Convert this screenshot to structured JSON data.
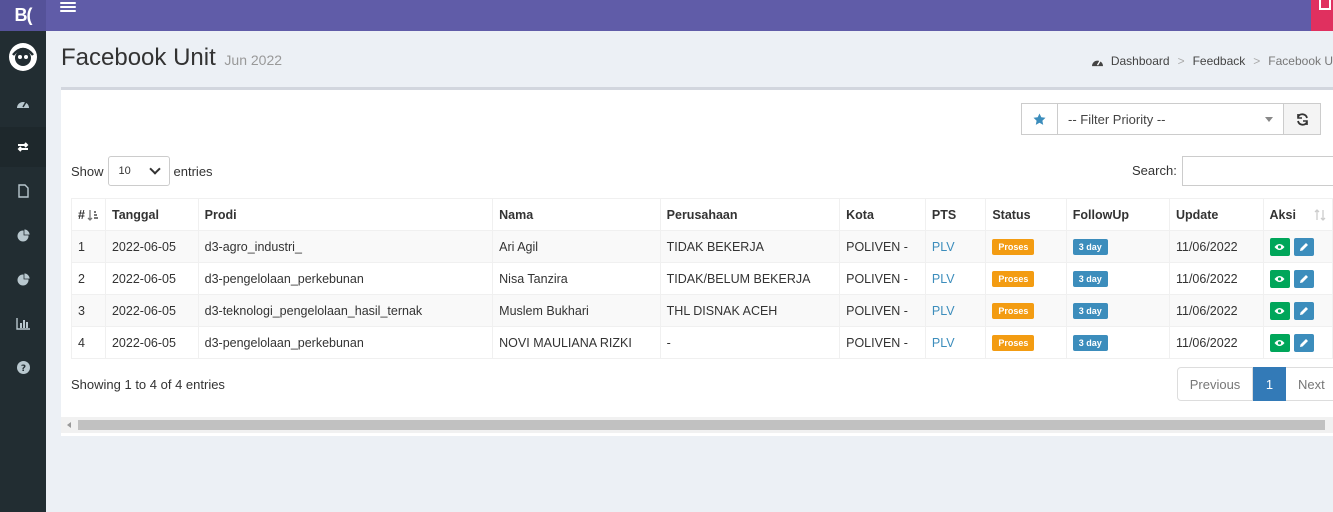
{
  "app": {
    "logo_text": "B("
  },
  "header": {
    "title": "Facebook Unit",
    "subtitle": "Jun 2022"
  },
  "breadcrumb": {
    "items": [
      "Dashboard",
      "Feedback",
      "Facebook U"
    ]
  },
  "filter": {
    "placeholder": "-- Filter Priority --"
  },
  "datatable": {
    "show_label": "Show",
    "entries_label": "entries",
    "length_value": "10",
    "search_label": "Search:",
    "search_value": "",
    "info": "Showing 1 to 4 of 4 entries",
    "pagination": {
      "previous": "Previous",
      "current": "1",
      "next": "Next"
    }
  },
  "table": {
    "columns": [
      "#",
      "Tanggal",
      "Prodi",
      "Nama",
      "Perusahaan",
      "Kota",
      "PTS",
      "Status",
      "FollowUp",
      "Update",
      "Aksi"
    ],
    "rows": [
      {
        "no": "1",
        "tanggal": "2022-06-05",
        "prodi": "d3-agro_industri_",
        "nama": "Ari Agil",
        "perusahaan": "TIDAK BEKERJA",
        "kota": "POLIVEN -",
        "pts": "PLV",
        "status": "Proses",
        "followup": "3 day",
        "update": "11/06/2022"
      },
      {
        "no": "2",
        "tanggal": "2022-06-05",
        "prodi": "d3-pengelolaan_perkebunan",
        "nama": "Nisa Tanzira",
        "perusahaan": "TIDAK/BELUM BEKERJA",
        "kota": "POLIVEN -",
        "pts": "PLV",
        "status": "Proses",
        "followup": "3 day",
        "update": "11/06/2022"
      },
      {
        "no": "3",
        "tanggal": "2022-06-05",
        "prodi": "d3-teknologi_pengelolaan_hasil_ternak",
        "nama": "Muslem Bukhari",
        "perusahaan": "THL DISNAK ACEH",
        "kota": "POLIVEN -",
        "pts": "PLV",
        "status": "Proses",
        "followup": "3 day",
        "update": "11/06/2022"
      },
      {
        "no": "4",
        "tanggal": "2022-06-05",
        "prodi": "d3-pengelolaan_perkebunan",
        "nama": "NOVI MAULIANA RIZKI",
        "perusahaan": "-",
        "kota": "POLIVEN -",
        "pts": "PLV",
        "status": "Proses",
        "followup": "3 day",
        "update": "11/06/2022"
      }
    ]
  },
  "icons": {
    "sidebar": [
      "dashboard-icon",
      "exchange-icon",
      "file-icon",
      "pie-chart-icon",
      "pie-chart-icon",
      "bar-chart-icon",
      "question-icon"
    ],
    "filter_star": "star-icon",
    "refresh": "refresh-icon",
    "row_actions": [
      "eye-icon",
      "pencil-icon"
    ]
  },
  "colors": {
    "topbar": "#605ca8",
    "sidebar": "#222d32",
    "proses_badge": "#f39c12",
    "followup_badge": "#3c8dbc",
    "view_button": "#00a65a",
    "edit_button": "#3c8dbc",
    "pagination_active": "#337ab7"
  }
}
